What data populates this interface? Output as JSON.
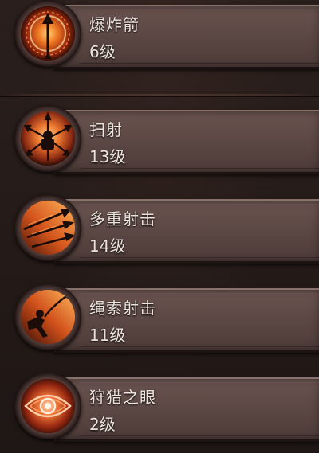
{
  "skills": [
    {
      "name": "爆炸箭",
      "level": "6级",
      "icon": "explosive-arrow-icon"
    },
    {
      "name": "扫射",
      "level": "13级",
      "icon": "strafe-icon"
    },
    {
      "name": "多重射击",
      "level": "14级",
      "icon": "multishot-icon"
    },
    {
      "name": "绳索射击",
      "level": "11级",
      "icon": "rope-shot-icon"
    },
    {
      "name": "狩猎之眼",
      "level": "2级",
      "icon": "hunters-eye-icon"
    }
  ],
  "colors": {
    "panel": "#5c4844",
    "text": "#ece3dc",
    "ember": "#e0531c",
    "background": "#241a18"
  }
}
